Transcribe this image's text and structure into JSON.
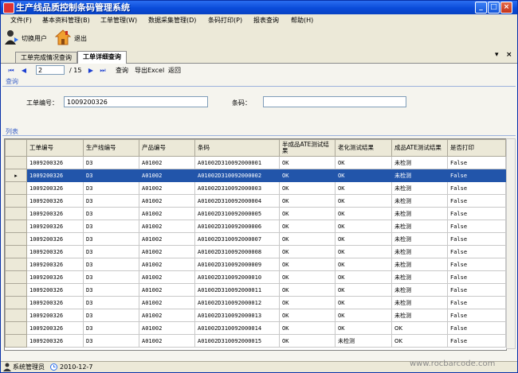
{
  "window": {
    "title": "生产线品质控制条码管理系统",
    "min": "_",
    "max": "□",
    "close": "×"
  },
  "menu": [
    "文件(F)",
    "基本资料管理(B)",
    "工单管理(W)",
    "数据采集管理(D)",
    "条码打印(P)",
    "报表查询",
    "帮助(H)"
  ],
  "toolbar": {
    "switch_user": "切换用户",
    "exit": "退出"
  },
  "tabs": [
    {
      "label": "工单完成情况查询"
    },
    {
      "label": "工单详细查询"
    }
  ],
  "tab_controls": {
    "dropdown": "▾",
    "close": "×"
  },
  "nav": {
    "first": "⏮",
    "prev": "◀",
    "page": "2",
    "total": "/ 15",
    "next": "▶",
    "last": "⏭",
    "query": "查询",
    "export": "导出Excel",
    "back": "返回"
  },
  "query_section": {
    "title": "查询",
    "order_label": "工单编号：",
    "order_value": "1009200326",
    "barcode_label": "条码：",
    "barcode_value": ""
  },
  "list_section": {
    "title": "列表"
  },
  "grid": {
    "columns": [
      "工单编号",
      "生产线编号",
      "产品编号",
      "条码",
      "半成品ATE测试结果",
      "老化测试结果",
      "成品ATE测试结果",
      "是否打印"
    ],
    "selected_index": 1,
    "row_marker": "▸",
    "rows": [
      [
        "1009200326",
        "D3",
        "A01002",
        "A01002D310092000001",
        "OK",
        "OK",
        "未检测",
        "False"
      ],
      [
        "1009200326",
        "D3",
        "A01002",
        "A01002D310092000002",
        "OK",
        "OK",
        "未检测",
        "False"
      ],
      [
        "1009200326",
        "D3",
        "A01002",
        "A01002D310092000003",
        "OK",
        "OK",
        "未检测",
        "False"
      ],
      [
        "1009200326",
        "D3",
        "A01002",
        "A01002D310092000004",
        "OK",
        "OK",
        "未检测",
        "False"
      ],
      [
        "1009200326",
        "D3",
        "A01002",
        "A01002D310092000005",
        "OK",
        "OK",
        "未检测",
        "False"
      ],
      [
        "1009200326",
        "D3",
        "A01002",
        "A01002D310092000006",
        "OK",
        "OK",
        "未检测",
        "False"
      ],
      [
        "1009200326",
        "D3",
        "A01002",
        "A01002D310092000007",
        "OK",
        "OK",
        "未检测",
        "False"
      ],
      [
        "1009200326",
        "D3",
        "A01002",
        "A01002D310092000008",
        "OK",
        "OK",
        "未检测",
        "False"
      ],
      [
        "1009200326",
        "D3",
        "A01002",
        "A01002D310092000009",
        "OK",
        "OK",
        "未检测",
        "False"
      ],
      [
        "1009200326",
        "D3",
        "A01002",
        "A01002D310092000010",
        "OK",
        "OK",
        "未检测",
        "False"
      ],
      [
        "1009200326",
        "D3",
        "A01002",
        "A01002D310092000011",
        "OK",
        "OK",
        "未检测",
        "False"
      ],
      [
        "1009200326",
        "D3",
        "A01002",
        "A01002D310092000012",
        "OK",
        "OK",
        "未检测",
        "False"
      ],
      [
        "1009200326",
        "D3",
        "A01002",
        "A01002D310092000013",
        "OK",
        "OK",
        "未检测",
        "False"
      ],
      [
        "1009200326",
        "D3",
        "A01002",
        "A01002D310092000014",
        "OK",
        "OK",
        "OK",
        "False"
      ],
      [
        "1009200326",
        "D3",
        "A01002",
        "A01002D310092000015",
        "OK",
        "未检测",
        "OK",
        "False"
      ]
    ]
  },
  "status": {
    "user": "系统管理员",
    "date": "2010-12-7"
  },
  "watermark": "www.rocbarcode.com",
  "colors": {
    "titlebar": "#0a4bd9",
    "selection": "#2255aa",
    "chrome": "#ece9d8"
  }
}
